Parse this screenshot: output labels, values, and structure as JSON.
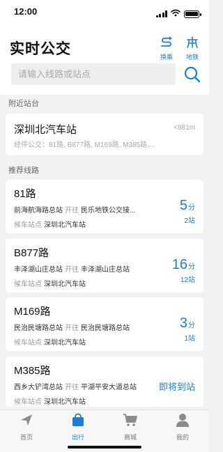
{
  "status": {
    "time": "12:00"
  },
  "header": {
    "title": "实时公交",
    "transfer_label": "换乘",
    "metro_label": "地铁",
    "search_placeholder": "请输入线路或站点"
  },
  "nearby": {
    "section_title": "附近站台",
    "station_name": "深圳北汽车站",
    "distance": "<881m",
    "passing_routes": "经停公交：81路, B877路, M169路, M385路,..."
  },
  "recommended": {
    "section_title": "推荐线路",
    "routes": [
      {
        "name": "81路",
        "from": "前海航海路总站",
        "dir_label": "开往",
        "to": "民乐地铁公交接...",
        "wait_label": "候车站点",
        "wait_stop": "深圳北汽车站",
        "eta_num": "5",
        "eta_unit": "分",
        "eta_stops": "2站"
      },
      {
        "name": "B877路",
        "from": "丰泽湖山庄总站",
        "dir_label": "开往",
        "to": "丰泽湖山庄总站",
        "wait_label": "候车站点",
        "wait_stop": "深圳北汽车站",
        "eta_num": "16",
        "eta_unit": "分",
        "eta_stops": "12站"
      },
      {
        "name": "M169路",
        "from": "民治民塘路总站",
        "dir_label": "开往",
        "to": "民治民塘路总站",
        "wait_label": "候车站点",
        "wait_stop": "深圳北汽车站",
        "eta_num": "3",
        "eta_unit": "分",
        "eta_stops": "1站"
      },
      {
        "name": "M385路",
        "from": "西乡大铲湾总站",
        "dir_label": "开往",
        "to": "平湖平安大道总站",
        "wait_label": "候车站点",
        "wait_stop": "深圳北汽车站",
        "eta_text": "即将到站"
      }
    ]
  },
  "tabbar": {
    "items": [
      {
        "label": "首页",
        "icon": "navigation-arrow-icon"
      },
      {
        "label": "出行",
        "icon": "shopping-bag-icon"
      },
      {
        "label": "商城",
        "icon": "cart-icon"
      },
      {
        "label": "我的",
        "icon": "person-icon"
      }
    ]
  },
  "colors": {
    "accent": "#1a7fd6",
    "background": "#f2f2f4"
  }
}
